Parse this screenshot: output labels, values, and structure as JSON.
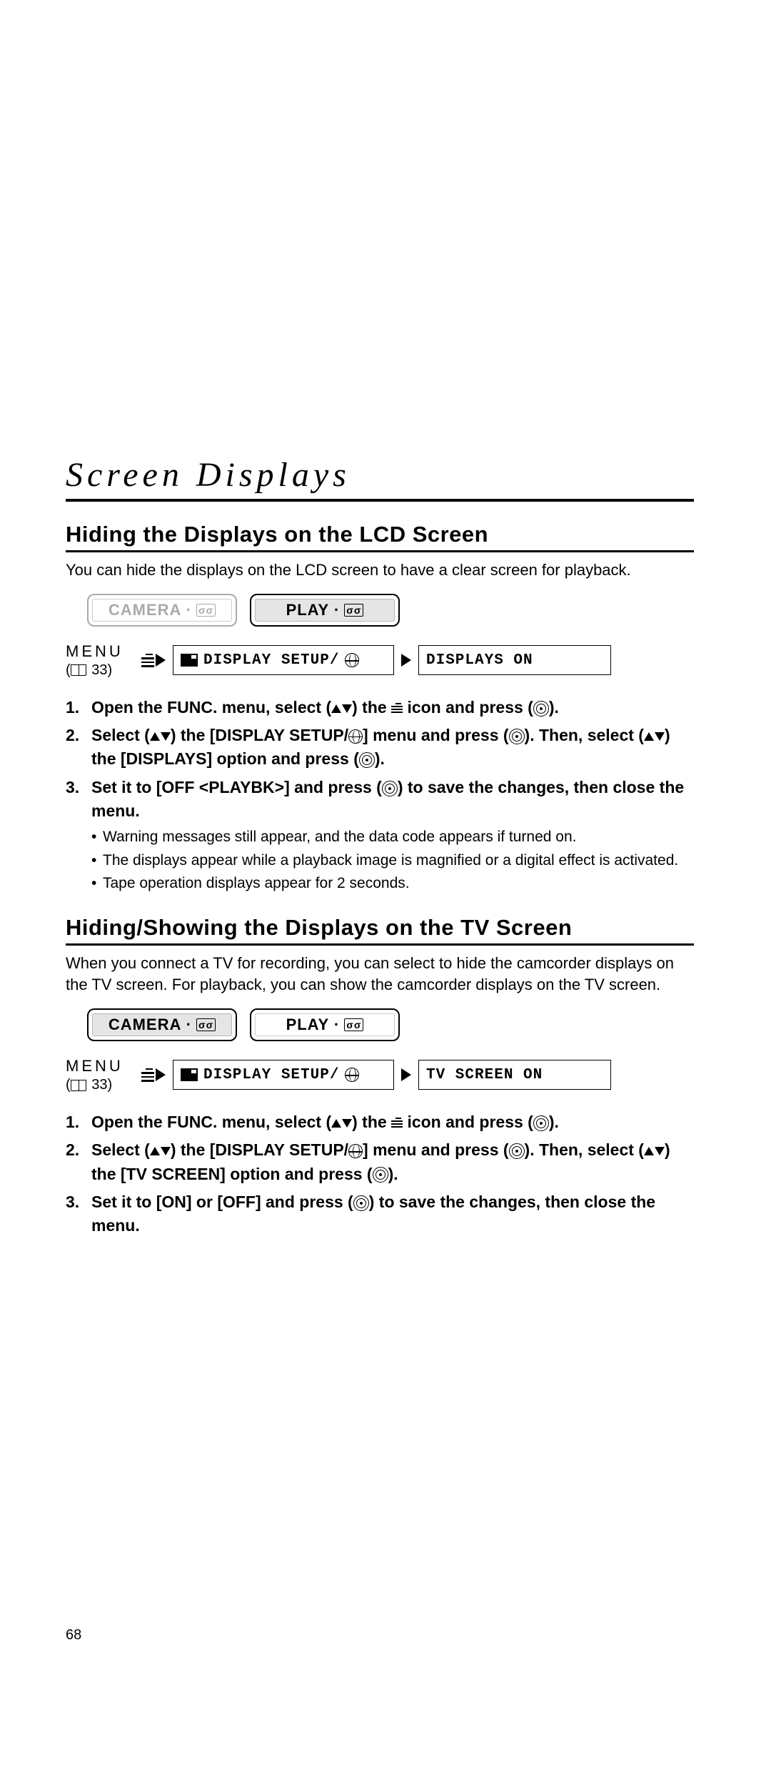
{
  "chapter_title": "Screen Displays",
  "page_number": "68",
  "section1": {
    "title": "Hiding the Displays on the LCD Screen",
    "intro": "You can hide the displays on the LCD screen to have a clear screen for playback.",
    "mode_camera": "CAMERA ·",
    "mode_play": "PLAY ·",
    "menu_label": "MENU",
    "menu_ref": "33",
    "menu_setup": "DISPLAY SETUP/",
    "menu_value": "DISPLAYS ON",
    "step1_a": "Open the FUNC. menu, select (",
    "step1_b": ") the ",
    "step1_c": " icon and press (",
    "step1_d": ").",
    "step2_a": "Select (",
    "step2_b": ") the [DISPLAY SETUP/",
    "step2_c": "] menu and press (",
    "step2_d": "). Then, select (",
    "step2_e": ") the [DISPLAYS] option and press (",
    "step2_f": ").",
    "step3_a": "Set it to [OFF <PLAYBK>] and press (",
    "step3_b": ") to save the changes, then close the menu.",
    "bullets": [
      "Warning messages still appear, and the data code appears if turned on.",
      "The displays appear while a playback image is magnified or a digital effect is activated.",
      "Tape operation displays appear for 2 seconds."
    ]
  },
  "section2": {
    "title": "Hiding/Showing the Displays on the TV Screen",
    "intro": "When you connect a TV for recording, you can select to hide the camcorder displays on the TV screen. For playback, you can show the camcorder displays on the TV screen.",
    "mode_camera": "CAMERA ·",
    "mode_play": "PLAY ·",
    "menu_label": "MENU",
    "menu_ref": "33",
    "menu_setup": "DISPLAY SETUP/",
    "menu_value": "TV SCREEN ON",
    "step1_a": "Open the FUNC. menu, select (",
    "step1_b": ") the ",
    "step1_c": " icon and press (",
    "step1_d": ").",
    "step2_a": "Select (",
    "step2_b": ") the [DISPLAY SETUP/",
    "step2_c": "] menu and press (",
    "step2_d": "). Then, select (",
    "step2_e": ") the [TV SCREEN] option and press (",
    "step2_f": ").",
    "step3_a": "Set it to [ON] or [OFF] and press (",
    "step3_b": ") to save the changes, then close the menu."
  }
}
